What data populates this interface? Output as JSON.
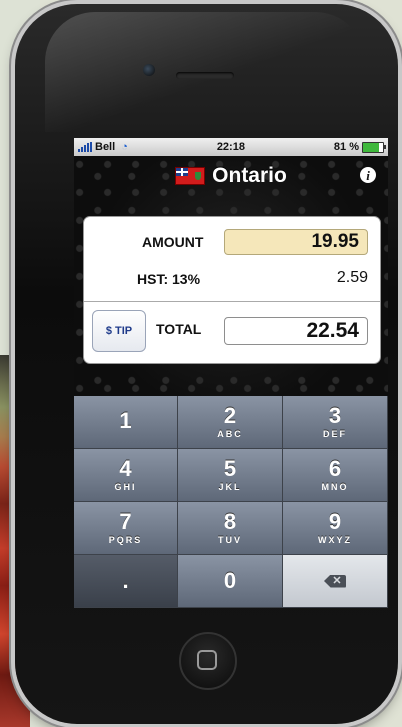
{
  "status_bar": {
    "carrier": "Bell",
    "time": "22:18",
    "battery": "81 %",
    "battery_level": 0.81
  },
  "nav": {
    "title": "Ontario",
    "info": "i"
  },
  "calculator": {
    "amount_label": "AMOUNT",
    "amount_value": "19.95",
    "hst_label": "HST: 13%",
    "hst_value": "2.59",
    "tip_label": "$ TIP",
    "total_label": "TOTAL",
    "total_value": "22.54"
  },
  "keypad": {
    "keys": [
      {
        "digit": "1",
        "letters": ""
      },
      {
        "digit": "2",
        "letters": "ABC"
      },
      {
        "digit": "3",
        "letters": "DEF"
      },
      {
        "digit": "4",
        "letters": "GHI"
      },
      {
        "digit": "5",
        "letters": "JKL"
      },
      {
        "digit": "6",
        "letters": "MNO"
      },
      {
        "digit": "7",
        "letters": "PQRS"
      },
      {
        "digit": "8",
        "letters": "TUV"
      },
      {
        "digit": "9",
        "letters": "WXYZ"
      }
    ],
    "dot": ".",
    "zero": "0",
    "backspace_icon": "backspace-icon"
  },
  "colors": {
    "amount_field_bg": "#f5e7ba",
    "keypad_key": "#6e7888",
    "tip_text": "#1e3a8a"
  }
}
